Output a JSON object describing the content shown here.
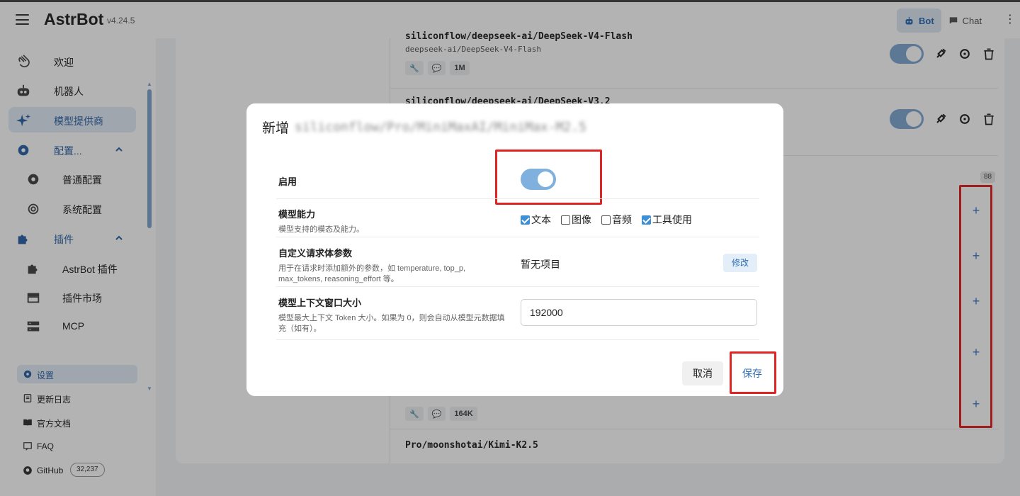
{
  "app": {
    "title": "AstrBot",
    "version": "v4.24.5"
  },
  "mode_tabs": [
    {
      "label": "Bot",
      "active": true
    },
    {
      "label": "Chat",
      "active": false
    }
  ],
  "sidebar": {
    "items": [
      {
        "label": "欢迎",
        "icon": "hand-wave-icon"
      },
      {
        "label": "机器人",
        "icon": "robot-icon"
      },
      {
        "label": "模型提供商",
        "icon": "sparkle-icon",
        "active": true
      },
      {
        "label": "配置...",
        "icon": "gear-icon"
      },
      {
        "label": "普通配置",
        "icon": "gear-icon"
      },
      {
        "label": "系统配置",
        "icon": "gear-outline-icon"
      },
      {
        "label": "插件",
        "icon": "puzzle-icon"
      },
      {
        "label": "AstrBot 插件",
        "icon": "puzzle-icon"
      },
      {
        "label": "插件市场",
        "icon": "store-icon"
      },
      {
        "label": "MCP",
        "icon": "server-icon"
      }
    ],
    "bottom": [
      {
        "label": "设置",
        "icon": "gear-icon"
      },
      {
        "label": "更新日志",
        "icon": "document-icon"
      },
      {
        "label": "官方文档",
        "icon": "book-icon"
      },
      {
        "label": "FAQ",
        "icon": "faq-icon"
      },
      {
        "label": "GitHub",
        "icon": "github-icon",
        "count": "32,237"
      }
    ]
  },
  "models": [
    {
      "name": "siliconflow/deepseek-ai/DeepSeek-V4-Flash",
      "sub": "deepseek-ai/DeepSeek-V4-Flash",
      "context_tag": "1M"
    },
    {
      "name": "siliconflow/deepseek-ai/DeepSeek-V3.2"
    },
    {
      "context_tag": "164K"
    },
    {
      "name": "Pro/moonshotai/Kimi-K2.5"
    }
  ],
  "available_count": "88",
  "dialog": {
    "title": "新增",
    "model_id": "siliconflow/Pro/MiniMaxAI/MiniMax-M2.5",
    "enable_label": "启用",
    "enabled": true,
    "capability_label": "模型能力",
    "capability_hint": "模型支持的模态及能力。",
    "capabilities": [
      {
        "label": "文本",
        "checked": true
      },
      {
        "label": "图像",
        "checked": false
      },
      {
        "label": "音频",
        "checked": false
      },
      {
        "label": "工具使用",
        "checked": true
      }
    ],
    "custom_params_label": "自定义请求体参数",
    "custom_params_hint": "用于在请求时添加额外的参数，如 temperature, top_p, max_tokens, reasoning_effort 等。",
    "custom_params_empty": "暂无项目",
    "edit_label": "修改",
    "context_label": "模型上下文窗口大小",
    "context_hint": "模型最大上下文 Token 大小。如果为 0，则会自动从模型元数据填充（如有）。",
    "context_value": "192000",
    "cancel_label": "取消",
    "save_label": "保存"
  },
  "colors": {
    "accent": "#2e6fb3",
    "highlight_box": "#e02424",
    "toggle_on": "#7fb0de"
  }
}
